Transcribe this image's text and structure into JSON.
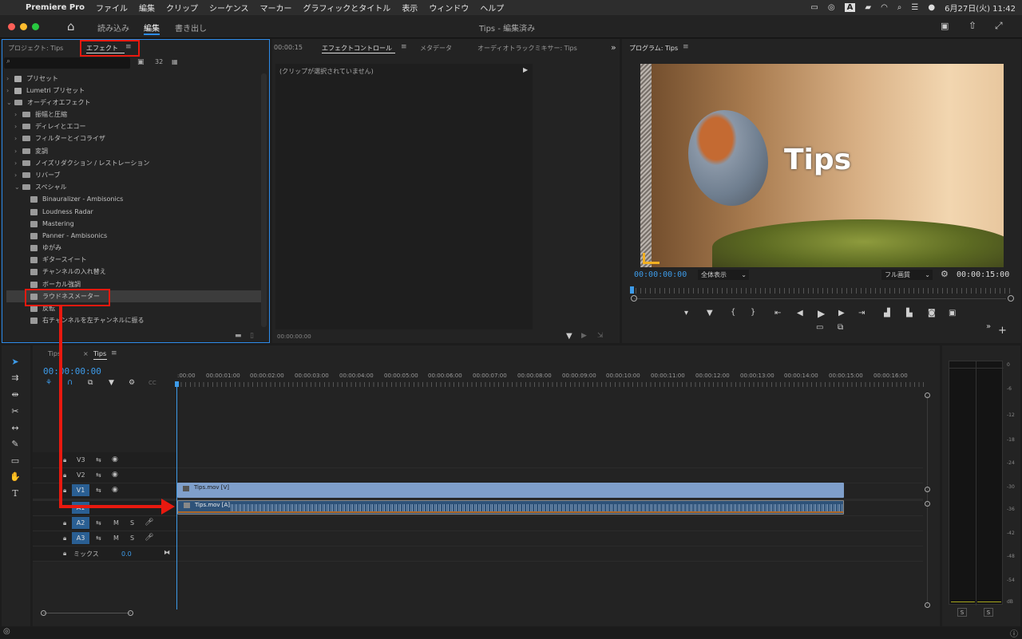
{
  "menu": {
    "apple": "",
    "app": "Premiere Pro",
    "items": [
      "ファイル",
      "編集",
      "クリップ",
      "シーケンス",
      "マーカー",
      "グラフィックとタイトル",
      "表示",
      "ウィンドウ",
      "ヘルプ"
    ],
    "clock": "6月27日(火) 11:42"
  },
  "window": {
    "title": "Tips - 編集済み",
    "workspaces": [
      "読み込み",
      "編集",
      "書き出し"
    ]
  },
  "left_panel": {
    "tab_project": "プロジェクト: Tips",
    "tab_effects": "エフェクト",
    "search_placeholder": "",
    "tree": [
      {
        "label": "プリセット",
        "level": 0,
        "type": "folder",
        "expanded": false
      },
      {
        "label": "Lumetri プリセット",
        "level": 0,
        "type": "folder",
        "expanded": false
      },
      {
        "label": "オーディオエフェクト",
        "level": 0,
        "type": "folder",
        "expanded": true
      },
      {
        "label": "振幅と圧縮",
        "level": 1,
        "type": "folder",
        "expanded": false
      },
      {
        "label": "ディレイとエコー",
        "level": 1,
        "type": "folder",
        "expanded": false
      },
      {
        "label": "フィルターとイコライザ",
        "level": 1,
        "type": "folder",
        "expanded": false
      },
      {
        "label": "変調",
        "level": 1,
        "type": "folder",
        "expanded": false
      },
      {
        "label": "ノイズリダクション / レストレーション",
        "level": 1,
        "type": "folder",
        "expanded": false
      },
      {
        "label": "リバーブ",
        "level": 1,
        "type": "folder",
        "expanded": false
      },
      {
        "label": "スペシャル",
        "level": 1,
        "type": "folder",
        "expanded": true
      },
      {
        "label": "Binauralizer - Ambisonics",
        "level": 2,
        "type": "effect"
      },
      {
        "label": "Loudness Radar",
        "level": 2,
        "type": "effect"
      },
      {
        "label": "Mastering",
        "level": 2,
        "type": "effect"
      },
      {
        "label": "Panner - Ambisonics",
        "level": 2,
        "type": "effect"
      },
      {
        "label": "ゆがみ",
        "level": 2,
        "type": "effect"
      },
      {
        "label": "ギタースイート",
        "level": 2,
        "type": "effect"
      },
      {
        "label": "チャンネルの入れ替え",
        "level": 2,
        "type": "effect"
      },
      {
        "label": "ボーカル強調",
        "level": 2,
        "type": "effect"
      },
      {
        "label": "ラウドネスメーター",
        "level": 2,
        "type": "effect",
        "selected": true
      },
      {
        "label": "反転",
        "level": 2,
        "type": "effect"
      },
      {
        "label": "右チャンネルを左チャンネルに振る",
        "level": 2,
        "type": "effect"
      }
    ]
  },
  "effect_controls": {
    "tabs": [
      "エフェクトコントロール",
      "メタデータ",
      "オーディオトラックミキサー: Tips"
    ],
    "timecode_top": "00:00:15",
    "no_clip": "(クリップが選択されていません)",
    "timecode_bottom": "00:00:00:00"
  },
  "program": {
    "title": "プログラム: Tips",
    "overlay_text": "Tips",
    "timecode": "00:00:00:00",
    "zoom": "全体表示",
    "quality": "フル画質",
    "duration": "00:00:15:00"
  },
  "timeline": {
    "tabs": [
      "Tips",
      "Tips"
    ],
    "timecode": "00:00:00:00",
    "ruler": [
      ":00:00",
      "00:00:01:00",
      "00:00:02:00",
      "00:00:03:00",
      "00:00:04:00",
      "00:00:05:00",
      "00:00:06:00",
      "00:00:07:00",
      "00:00:08:00",
      "00:00:09:00",
      "00:00:10:00",
      "00:00:11:00",
      "00:00:12:00",
      "00:00:13:00",
      "00:00:14:00",
      "00:00:15:00",
      "00:00:16:00"
    ],
    "video_tracks": [
      "V3",
      "V2",
      "V1"
    ],
    "audio_tracks": [
      "A1",
      "A2",
      "A3"
    ],
    "mix_label": "ミックス",
    "mix_value": "0.0",
    "clip_video": "Tips.mov [V]",
    "clip_audio": "Tips.mov [A]",
    "m": "M",
    "s": "S"
  },
  "meter": {
    "scale": [
      "0",
      "-6",
      "-12",
      "-18",
      "-24",
      "-30",
      "-36",
      "-42",
      "-48",
      "-54",
      "dB"
    ],
    "solo": [
      "S",
      "S"
    ]
  },
  "colors": {
    "accent": "#2d8ceb",
    "timecode": "#3d9be9",
    "highlight": "#e8190f",
    "clip_video": "#7f9fcb",
    "clip_audio": "#2e5279"
  }
}
